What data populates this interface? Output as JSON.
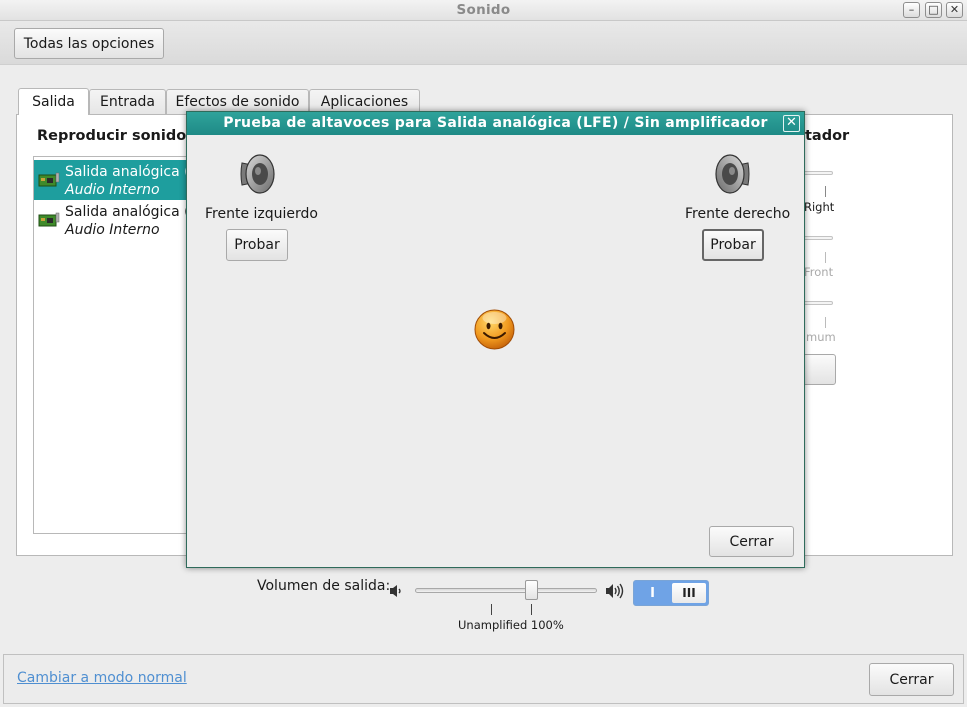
{
  "window": {
    "title": "Sonido"
  },
  "toolbar": {
    "all_settings_label": "Todas las opciones"
  },
  "tabs": [
    {
      "label": "Salida",
      "active": true
    },
    {
      "label": "Entrada",
      "active": false
    },
    {
      "label": "Efectos de sonido",
      "active": false
    },
    {
      "label": "Aplicaciones",
      "active": false
    }
  ],
  "output": {
    "section_title": "Reproducir sonido a",
    "section_title_right": "tador",
    "devices": [
      {
        "name": "Salida analógica (L",
        "description": "Audio Interno",
        "selected": true
      },
      {
        "name": "Salida analógica (L",
        "description": "Audio Interno",
        "selected": false
      }
    ],
    "right_labels": {
      "right": "Right",
      "front": "Front",
      "minimum": "mum"
    }
  },
  "volume": {
    "label": "Volumen de salida:",
    "tick_labels": "Unamplified 100%",
    "level_percent": 100,
    "toggle_on": "I",
    "toggle_off": "III"
  },
  "footer": {
    "mode_link": "Cambiar a modo normal",
    "close_label": "Cerrar"
  },
  "dialog": {
    "title": "Prueba de altavoces para Salida analógica (LFE) / Sin amplificador",
    "left_speaker": "Frente izquierdo",
    "right_speaker": "Frente derecho",
    "test_label": "Probar",
    "close_label": "Cerrar"
  },
  "colors": {
    "selection": "#1e9e9e",
    "dialog_title": "#2fa39b",
    "link": "#4f8fd1",
    "toggle_on": "#6fa3e6"
  }
}
